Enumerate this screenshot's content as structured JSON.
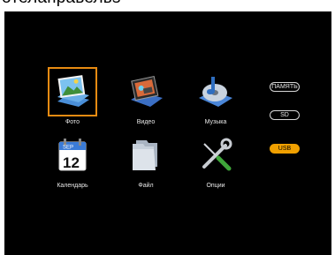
{
  "caption": "отелаправельs",
  "menu": {
    "photo": "Фото",
    "video": "Видео",
    "music": "Музыка",
    "calendar": "Календарь",
    "file": "Файл",
    "options": "Опции"
  },
  "calendar_icon": {
    "month": "SEP",
    "day": "12"
  },
  "storage": {
    "memory": "ПАМЯТЬ",
    "sd": "SD",
    "usb": "USB",
    "selected": "USB"
  },
  "colors": {
    "background": "#000000",
    "selection": "#e88b12",
    "active_storage": "#f0a000"
  }
}
